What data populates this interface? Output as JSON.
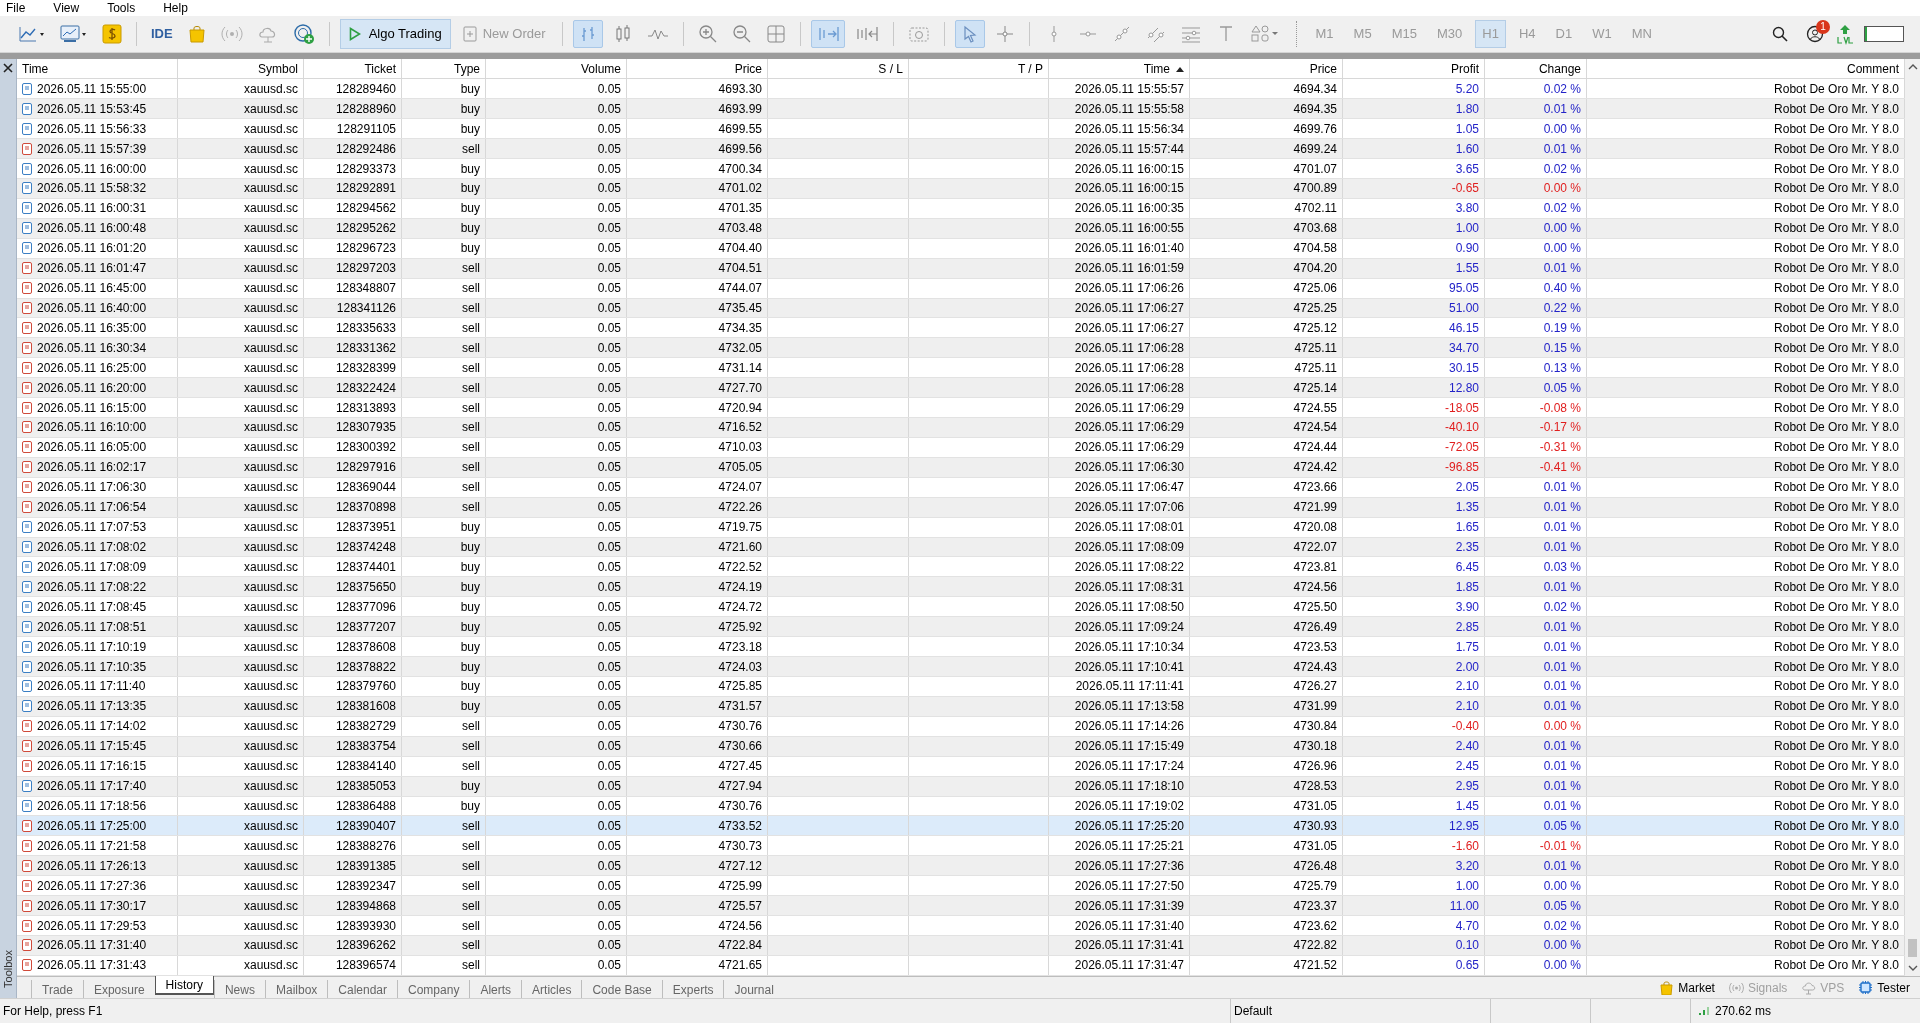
{
  "menu": [
    "File",
    "View",
    "Tools",
    "Help"
  ],
  "toolbar": {
    "ide": "IDE",
    "algo_trading": {
      "label": "Algo Trading",
      "on": true
    },
    "new_order": {
      "label": "New Order",
      "disabled": true
    },
    "timeframes": [
      {
        "label": "M1",
        "selected": false
      },
      {
        "label": "M5",
        "selected": false
      },
      {
        "label": "M15",
        "selected": false
      },
      {
        "label": "M30",
        "selected": false
      },
      {
        "label": "H1",
        "selected": true
      },
      {
        "label": "H4",
        "selected": false
      },
      {
        "label": "D1",
        "selected": false
      },
      {
        "label": "W1",
        "selected": false
      },
      {
        "label": "MN",
        "selected": false
      }
    ],
    "notifications": "1",
    "meter": {
      "level": 0.05
    }
  },
  "side_label": "Toolbox",
  "table": {
    "columns": [
      {
        "label": "Time",
        "sorted": false
      },
      {
        "label": "Symbol",
        "sorted": false
      },
      {
        "label": "Ticket",
        "sorted": false
      },
      {
        "label": "Type",
        "sorted": false
      },
      {
        "label": "Volume",
        "sorted": false
      },
      {
        "label": "Price",
        "sorted": false
      },
      {
        "label": "S / L",
        "sorted": false
      },
      {
        "label": "T / P",
        "sorted": false
      },
      {
        "label": "Time",
        "sorted": true
      },
      {
        "label": "Price",
        "sorted": false
      },
      {
        "label": "Profit",
        "sorted": false
      },
      {
        "label": "Change",
        "sorted": false
      },
      {
        "label": "Comment",
        "sorted": false
      }
    ],
    "rows": [
      {
        "time": "2026.05.11 15:55:00",
        "symbol": "xauusd.sc",
        "ticket": "128289460",
        "type": "buy",
        "kind": "buy",
        "volume": "0.05",
        "price": "4693.30",
        "close_time": "2026.05.11 15:55:57",
        "close_price": "4694.34",
        "profit": "5.20",
        "change": "0.02 %",
        "negative": false,
        "comment": "Robot De Oro Mr. Y 8.0",
        "selected": false
      },
      {
        "time": "2026.05.11 15:53:45",
        "symbol": "xauusd.sc",
        "ticket": "128288960",
        "type": "buy",
        "kind": "buy",
        "volume": "0.05",
        "price": "4693.99",
        "close_time": "2026.05.11 15:55:58",
        "close_price": "4694.35",
        "profit": "1.80",
        "change": "0.01 %",
        "negative": false,
        "comment": "Robot De Oro Mr. Y 8.0",
        "selected": false
      },
      {
        "time": "2026.05.11 15:56:33",
        "symbol": "xauusd.sc",
        "ticket": "128291105",
        "type": "buy",
        "kind": "buy",
        "volume": "0.05",
        "price": "4699.55",
        "close_time": "2026.05.11 15:56:34",
        "close_price": "4699.76",
        "profit": "1.05",
        "change": "0.00 %",
        "negative": false,
        "comment": "Robot De Oro Mr. Y 8.0",
        "selected": false
      },
      {
        "time": "2026.05.11 15:57:39",
        "symbol": "xauusd.sc",
        "ticket": "128292486",
        "type": "sell",
        "kind": "sell",
        "volume": "0.05",
        "price": "4699.56",
        "close_time": "2026.05.11 15:57:44",
        "close_price": "4699.24",
        "profit": "1.60",
        "change": "0.01 %",
        "negative": false,
        "comment": "Robot De Oro Mr. Y 8.0",
        "selected": false
      },
      {
        "time": "2026.05.11 16:00:00",
        "symbol": "xauusd.sc",
        "ticket": "128293373",
        "type": "buy",
        "kind": "buy",
        "volume": "0.05",
        "price": "4700.34",
        "close_time": "2026.05.11 16:00:15",
        "close_price": "4701.07",
        "profit": "3.65",
        "change": "0.02 %",
        "negative": false,
        "comment": "Robot De Oro Mr. Y 8.0",
        "selected": false
      },
      {
        "time": "2026.05.11 15:58:32",
        "symbol": "xauusd.sc",
        "ticket": "128292891",
        "type": "buy",
        "kind": "buy",
        "volume": "0.05",
        "price": "4701.02",
        "close_time": "2026.05.11 16:00:15",
        "close_price": "4700.89",
        "profit": "-0.65",
        "change": "0.00 %",
        "negative": true,
        "comment": "Robot De Oro Mr. Y 8.0",
        "selected": false
      },
      {
        "time": "2026.05.11 16:00:31",
        "symbol": "xauusd.sc",
        "ticket": "128294562",
        "type": "buy",
        "kind": "buy",
        "volume": "0.05",
        "price": "4701.35",
        "close_time": "2026.05.11 16:00:35",
        "close_price": "4702.11",
        "profit": "3.80",
        "change": "0.02 %",
        "negative": false,
        "comment": "Robot De Oro Mr. Y 8.0",
        "selected": false
      },
      {
        "time": "2026.05.11 16:00:48",
        "symbol": "xauusd.sc",
        "ticket": "128295262",
        "type": "buy",
        "kind": "buy",
        "volume": "0.05",
        "price": "4703.48",
        "close_time": "2026.05.11 16:00:55",
        "close_price": "4703.68",
        "profit": "1.00",
        "change": "0.00 %",
        "negative": false,
        "comment": "Robot De Oro Mr. Y 8.0",
        "selected": false
      },
      {
        "time": "2026.05.11 16:01:20",
        "symbol": "xauusd.sc",
        "ticket": "128296723",
        "type": "buy",
        "kind": "buy",
        "volume": "0.05",
        "price": "4704.40",
        "close_time": "2026.05.11 16:01:40",
        "close_price": "4704.58",
        "profit": "0.90",
        "change": "0.00 %",
        "negative": false,
        "comment": "Robot De Oro Mr. Y 8.0",
        "selected": false
      },
      {
        "time": "2026.05.11 16:01:47",
        "symbol": "xauusd.sc",
        "ticket": "128297203",
        "type": "sell",
        "kind": "sell",
        "volume": "0.05",
        "price": "4704.51",
        "close_time": "2026.05.11 16:01:59",
        "close_price": "4704.20",
        "profit": "1.55",
        "change": "0.01 %",
        "negative": false,
        "comment": "Robot De Oro Mr. Y 8.0",
        "selected": false
      },
      {
        "time": "2026.05.11 16:45:00",
        "symbol": "xauusd.sc",
        "ticket": "128348807",
        "type": "sell",
        "kind": "sell",
        "volume": "0.05",
        "price": "4744.07",
        "close_time": "2026.05.11 17:06:26",
        "close_price": "4725.06",
        "profit": "95.05",
        "change": "0.40 %",
        "negative": false,
        "comment": "Robot De Oro Mr. Y 8.0",
        "selected": false
      },
      {
        "time": "2026.05.11 16:40:00",
        "symbol": "xauusd.sc",
        "ticket": "128341126",
        "type": "sell",
        "kind": "sell",
        "volume": "0.05",
        "price": "4735.45",
        "close_time": "2026.05.11 17:06:27",
        "close_price": "4725.25",
        "profit": "51.00",
        "change": "0.22 %",
        "negative": false,
        "comment": "Robot De Oro Mr. Y 8.0",
        "selected": false
      },
      {
        "time": "2026.05.11 16:35:00",
        "symbol": "xauusd.sc",
        "ticket": "128335633",
        "type": "sell",
        "kind": "sell",
        "volume": "0.05",
        "price": "4734.35",
        "close_time": "2026.05.11 17:06:27",
        "close_price": "4725.12",
        "profit": "46.15",
        "change": "0.19 %",
        "negative": false,
        "comment": "Robot De Oro Mr. Y 8.0",
        "selected": false
      },
      {
        "time": "2026.05.11 16:30:34",
        "symbol": "xauusd.sc",
        "ticket": "128331362",
        "type": "sell",
        "kind": "sell",
        "volume": "0.05",
        "price": "4732.05",
        "close_time": "2026.05.11 17:06:28",
        "close_price": "4725.11",
        "profit": "34.70",
        "change": "0.15 %",
        "negative": false,
        "comment": "Robot De Oro Mr. Y 8.0",
        "selected": false
      },
      {
        "time": "2026.05.11 16:25:00",
        "symbol": "xauusd.sc",
        "ticket": "128328399",
        "type": "sell",
        "kind": "sell",
        "volume": "0.05",
        "price": "4731.14",
        "close_time": "2026.05.11 17:06:28",
        "close_price": "4725.11",
        "profit": "30.15",
        "change": "0.13 %",
        "negative": false,
        "comment": "Robot De Oro Mr. Y 8.0",
        "selected": false
      },
      {
        "time": "2026.05.11 16:20:00",
        "symbol": "xauusd.sc",
        "ticket": "128322424",
        "type": "sell",
        "kind": "sell",
        "volume": "0.05",
        "price": "4727.70",
        "close_time": "2026.05.11 17:06:28",
        "close_price": "4725.14",
        "profit": "12.80",
        "change": "0.05 %",
        "negative": false,
        "comment": "Robot De Oro Mr. Y 8.0",
        "selected": false
      },
      {
        "time": "2026.05.11 16:15:00",
        "symbol": "xauusd.sc",
        "ticket": "128313893",
        "type": "sell",
        "kind": "sell",
        "volume": "0.05",
        "price": "4720.94",
        "close_time": "2026.05.11 17:06:29",
        "close_price": "4724.55",
        "profit": "-18.05",
        "change": "-0.08 %",
        "negative": true,
        "comment": "Robot De Oro Mr. Y 8.0",
        "selected": false
      },
      {
        "time": "2026.05.11 16:10:00",
        "symbol": "xauusd.sc",
        "ticket": "128307935",
        "type": "sell",
        "kind": "sell",
        "volume": "0.05",
        "price": "4716.52",
        "close_time": "2026.05.11 17:06:29",
        "close_price": "4724.54",
        "profit": "-40.10",
        "change": "-0.17 %",
        "negative": true,
        "comment": "Robot De Oro Mr. Y 8.0",
        "selected": false
      },
      {
        "time": "2026.05.11 16:05:00",
        "symbol": "xauusd.sc",
        "ticket": "128300392",
        "type": "sell",
        "kind": "sell",
        "volume": "0.05",
        "price": "4710.03",
        "close_time": "2026.05.11 17:06:29",
        "close_price": "4724.44",
        "profit": "-72.05",
        "change": "-0.31 %",
        "negative": true,
        "comment": "Robot De Oro Mr. Y 8.0",
        "selected": false
      },
      {
        "time": "2026.05.11 16:02:17",
        "symbol": "xauusd.sc",
        "ticket": "128297916",
        "type": "sell",
        "kind": "sell",
        "volume": "0.05",
        "price": "4705.05",
        "close_time": "2026.05.11 17:06:30",
        "close_price": "4724.42",
        "profit": "-96.85",
        "change": "-0.41 %",
        "negative": true,
        "comment": "Robot De Oro Mr. Y 8.0",
        "selected": false
      },
      {
        "time": "2026.05.11 17:06:30",
        "symbol": "xauusd.sc",
        "ticket": "128369044",
        "type": "sell",
        "kind": "sell",
        "volume": "0.05",
        "price": "4724.07",
        "close_time": "2026.05.11 17:06:47",
        "close_price": "4723.66",
        "profit": "2.05",
        "change": "0.01 %",
        "negative": false,
        "comment": "Robot De Oro Mr. Y 8.0",
        "selected": false
      },
      {
        "time": "2026.05.11 17:06:54",
        "symbol": "xauusd.sc",
        "ticket": "128370898",
        "type": "sell",
        "kind": "sell",
        "volume": "0.05",
        "price": "4722.26",
        "close_time": "2026.05.11 17:07:06",
        "close_price": "4721.99",
        "profit": "1.35",
        "change": "0.01 %",
        "negative": false,
        "comment": "Robot De Oro Mr. Y 8.0",
        "selected": false
      },
      {
        "time": "2026.05.11 17:07:53",
        "symbol": "xauusd.sc",
        "ticket": "128373951",
        "type": "buy",
        "kind": "buy",
        "volume": "0.05",
        "price": "4719.75",
        "close_time": "2026.05.11 17:08:01",
        "close_price": "4720.08",
        "profit": "1.65",
        "change": "0.01 %",
        "negative": false,
        "comment": "Robot De Oro Mr. Y 8.0",
        "selected": false
      },
      {
        "time": "2026.05.11 17:08:02",
        "symbol": "xauusd.sc",
        "ticket": "128374248",
        "type": "buy",
        "kind": "buy",
        "volume": "0.05",
        "price": "4721.60",
        "close_time": "2026.05.11 17:08:09",
        "close_price": "4722.07",
        "profit": "2.35",
        "change": "0.01 %",
        "negative": false,
        "comment": "Robot De Oro Mr. Y 8.0",
        "selected": false
      },
      {
        "time": "2026.05.11 17:08:09",
        "symbol": "xauusd.sc",
        "ticket": "128374401",
        "type": "buy",
        "kind": "buy",
        "volume": "0.05",
        "price": "4722.52",
        "close_time": "2026.05.11 17:08:22",
        "close_price": "4723.81",
        "profit": "6.45",
        "change": "0.03 %",
        "negative": false,
        "comment": "Robot De Oro Mr. Y 8.0",
        "selected": false
      },
      {
        "time": "2026.05.11 17:08:22",
        "symbol": "xauusd.sc",
        "ticket": "128375650",
        "type": "buy",
        "kind": "buy",
        "volume": "0.05",
        "price": "4724.19",
        "close_time": "2026.05.11 17:08:31",
        "close_price": "4724.56",
        "profit": "1.85",
        "change": "0.01 %",
        "negative": false,
        "comment": "Robot De Oro Mr. Y 8.0",
        "selected": false
      },
      {
        "time": "2026.05.11 17:08:45",
        "symbol": "xauusd.sc",
        "ticket": "128377096",
        "type": "buy",
        "kind": "buy",
        "volume": "0.05",
        "price": "4724.72",
        "close_time": "2026.05.11 17:08:50",
        "close_price": "4725.50",
        "profit": "3.90",
        "change": "0.02 %",
        "negative": false,
        "comment": "Robot De Oro Mr. Y 8.0",
        "selected": false
      },
      {
        "time": "2026.05.11 17:08:51",
        "symbol": "xauusd.sc",
        "ticket": "128377207",
        "type": "buy",
        "kind": "buy",
        "volume": "0.05",
        "price": "4725.92",
        "close_time": "2026.05.11 17:09:24",
        "close_price": "4726.49",
        "profit": "2.85",
        "change": "0.01 %",
        "negative": false,
        "comment": "Robot De Oro Mr. Y 8.0",
        "selected": false
      },
      {
        "time": "2026.05.11 17:10:19",
        "symbol": "xauusd.sc",
        "ticket": "128378608",
        "type": "buy",
        "kind": "buy",
        "volume": "0.05",
        "price": "4723.18",
        "close_time": "2026.05.11 17:10:34",
        "close_price": "4723.53",
        "profit": "1.75",
        "change": "0.01 %",
        "negative": false,
        "comment": "Robot De Oro Mr. Y 8.0",
        "selected": false
      },
      {
        "time": "2026.05.11 17:10:35",
        "symbol": "xauusd.sc",
        "ticket": "128378822",
        "type": "buy",
        "kind": "buy",
        "volume": "0.05",
        "price": "4724.03",
        "close_time": "2026.05.11 17:10:41",
        "close_price": "4724.43",
        "profit": "2.00",
        "change": "0.01 %",
        "negative": false,
        "comment": "Robot De Oro Mr. Y 8.0",
        "selected": false
      },
      {
        "time": "2026.05.11 17:11:40",
        "symbol": "xauusd.sc",
        "ticket": "128379760",
        "type": "buy",
        "kind": "buy",
        "volume": "0.05",
        "price": "4725.85",
        "close_time": "2026.05.11 17:11:41",
        "close_price": "4726.27",
        "profit": "2.10",
        "change": "0.01 %",
        "negative": false,
        "comment": "Robot De Oro Mr. Y 8.0",
        "selected": false
      },
      {
        "time": "2026.05.11 17:13:35",
        "symbol": "xauusd.sc",
        "ticket": "128381608",
        "type": "buy",
        "kind": "buy",
        "volume": "0.05",
        "price": "4731.57",
        "close_time": "2026.05.11 17:13:58",
        "close_price": "4731.99",
        "profit": "2.10",
        "change": "0.01 %",
        "negative": false,
        "comment": "Robot De Oro Mr. Y 8.0",
        "selected": false
      },
      {
        "time": "2026.05.11 17:14:02",
        "symbol": "xauusd.sc",
        "ticket": "128382729",
        "type": "sell",
        "kind": "sell",
        "volume": "0.05",
        "price": "4730.76",
        "close_time": "2026.05.11 17:14:26",
        "close_price": "4730.84",
        "profit": "-0.40",
        "change": "0.00 %",
        "negative": true,
        "comment": "Robot De Oro Mr. Y 8.0",
        "selected": false
      },
      {
        "time": "2026.05.11 17:15:45",
        "symbol": "xauusd.sc",
        "ticket": "128383754",
        "type": "sell",
        "kind": "sell",
        "volume": "0.05",
        "price": "4730.66",
        "close_time": "2026.05.11 17:15:49",
        "close_price": "4730.18",
        "profit": "2.40",
        "change": "0.01 %",
        "negative": false,
        "comment": "Robot De Oro Mr. Y 8.0",
        "selected": false
      },
      {
        "time": "2026.05.11 17:16:15",
        "symbol": "xauusd.sc",
        "ticket": "128384140",
        "type": "sell",
        "kind": "sell",
        "volume": "0.05",
        "price": "4727.45",
        "close_time": "2026.05.11 17:17:24",
        "close_price": "4726.96",
        "profit": "2.45",
        "change": "0.01 %",
        "negative": false,
        "comment": "Robot De Oro Mr. Y 8.0",
        "selected": false
      },
      {
        "time": "2026.05.11 17:17:40",
        "symbol": "xauusd.sc",
        "ticket": "128385053",
        "type": "buy",
        "kind": "buy",
        "volume": "0.05",
        "price": "4727.94",
        "close_time": "2026.05.11 17:18:10",
        "close_price": "4728.53",
        "profit": "2.95",
        "change": "0.01 %",
        "negative": false,
        "comment": "Robot De Oro Mr. Y 8.0",
        "selected": false
      },
      {
        "time": "2026.05.11 17:18:56",
        "symbol": "xauusd.sc",
        "ticket": "128386488",
        "type": "buy",
        "kind": "buy",
        "volume": "0.05",
        "price": "4730.76",
        "close_time": "2026.05.11 17:19:02",
        "close_price": "4731.05",
        "profit": "1.45",
        "change": "0.01 %",
        "negative": false,
        "comment": "Robot De Oro Mr. Y 8.0",
        "selected": false
      },
      {
        "time": "2026.05.11 17:25:00",
        "symbol": "xauusd.sc",
        "ticket": "128390407",
        "type": "sell",
        "kind": "sell",
        "volume": "0.05",
        "price": "4733.52",
        "close_time": "2026.05.11 17:25:20",
        "close_price": "4730.93",
        "profit": "12.95",
        "change": "0.05 %",
        "negative": false,
        "comment": "Robot De Oro Mr. Y 8.0",
        "selected": true
      },
      {
        "time": "2026.05.11 17:21:58",
        "symbol": "xauusd.sc",
        "ticket": "128388276",
        "type": "sell",
        "kind": "sell",
        "volume": "0.05",
        "price": "4730.73",
        "close_time": "2026.05.11 17:25:21",
        "close_price": "4731.05",
        "profit": "-1.60",
        "change": "-0.01 %",
        "negative": true,
        "comment": "Robot De Oro Mr. Y 8.0",
        "selected": false
      },
      {
        "time": "2026.05.11 17:26:13",
        "symbol": "xauusd.sc",
        "ticket": "128391385",
        "type": "sell",
        "kind": "sell",
        "volume": "0.05",
        "price": "4727.12",
        "close_time": "2026.05.11 17:27:36",
        "close_price": "4726.48",
        "profit": "3.20",
        "change": "0.01 %",
        "negative": false,
        "comment": "Robot De Oro Mr. Y 8.0",
        "selected": false
      },
      {
        "time": "2026.05.11 17:27:36",
        "symbol": "xauusd.sc",
        "ticket": "128392347",
        "type": "sell",
        "kind": "sell",
        "volume": "0.05",
        "price": "4725.99",
        "close_time": "2026.05.11 17:27:50",
        "close_price": "4725.79",
        "profit": "1.00",
        "change": "0.00 %",
        "negative": false,
        "comment": "Robot De Oro Mr. Y 8.0",
        "selected": false
      },
      {
        "time": "2026.05.11 17:30:17",
        "symbol": "xauusd.sc",
        "ticket": "128394868",
        "type": "sell",
        "kind": "sell",
        "volume": "0.05",
        "price": "4725.57",
        "close_time": "2026.05.11 17:31:39",
        "close_price": "4723.37",
        "profit": "11.00",
        "change": "0.05 %",
        "negative": false,
        "comment": "Robot De Oro Mr. Y 8.0",
        "selected": false
      },
      {
        "time": "2026.05.11 17:29:53",
        "symbol": "xauusd.sc",
        "ticket": "128393930",
        "type": "sell",
        "kind": "sell",
        "volume": "0.05",
        "price": "4724.56",
        "close_time": "2026.05.11 17:31:40",
        "close_price": "4723.62",
        "profit": "4.70",
        "change": "0.02 %",
        "negative": false,
        "comment": "Robot De Oro Mr. Y 8.0",
        "selected": false
      },
      {
        "time": "2026.05.11 17:31:40",
        "symbol": "xauusd.sc",
        "ticket": "128396262",
        "type": "sell",
        "kind": "sell",
        "volume": "0.05",
        "price": "4722.84",
        "close_time": "2026.05.11 17:31:41",
        "close_price": "4722.82",
        "profit": "0.10",
        "change": "0.00 %",
        "negative": false,
        "comment": "Robot De Oro Mr. Y 8.0",
        "selected": false
      },
      {
        "time": "2026.05.11 17:31:43",
        "symbol": "xauusd.sc",
        "ticket": "128396574",
        "type": "sell",
        "kind": "sell",
        "volume": "0.05",
        "price": "4721.65",
        "close_time": "2026.05.11 17:31:47",
        "close_price": "4721.52",
        "profit": "0.65",
        "change": "0.00 %",
        "negative": false,
        "comment": "Robot De Oro Mr. Y 8.0",
        "selected": false
      }
    ]
  },
  "bottom_tabs": [
    {
      "label": "Trade",
      "selected": false
    },
    {
      "label": "Exposure",
      "selected": false
    },
    {
      "label": "History",
      "selected": true
    },
    {
      "label": "News",
      "selected": false
    },
    {
      "label": "Mailbox",
      "selected": false
    },
    {
      "label": "Calendar",
      "selected": false
    },
    {
      "label": "Company",
      "selected": false
    },
    {
      "label": "Alerts",
      "selected": false
    },
    {
      "label": "Articles",
      "selected": false
    },
    {
      "label": "Code Base",
      "selected": false
    },
    {
      "label": "Experts",
      "selected": false
    },
    {
      "label": "Journal",
      "selected": false
    }
  ],
  "services": [
    {
      "label": "Market",
      "kind": "bag",
      "disabled": false
    },
    {
      "label": "Signals",
      "kind": "signal",
      "disabled": true
    },
    {
      "label": "VPS",
      "kind": "cloud",
      "disabled": true
    },
    {
      "label": "Tester",
      "kind": "chip",
      "disabled": false
    }
  ],
  "status_bar": {
    "help": "For Help, press F1",
    "profile": "Default",
    "ping": "270.62 ms"
  }
}
